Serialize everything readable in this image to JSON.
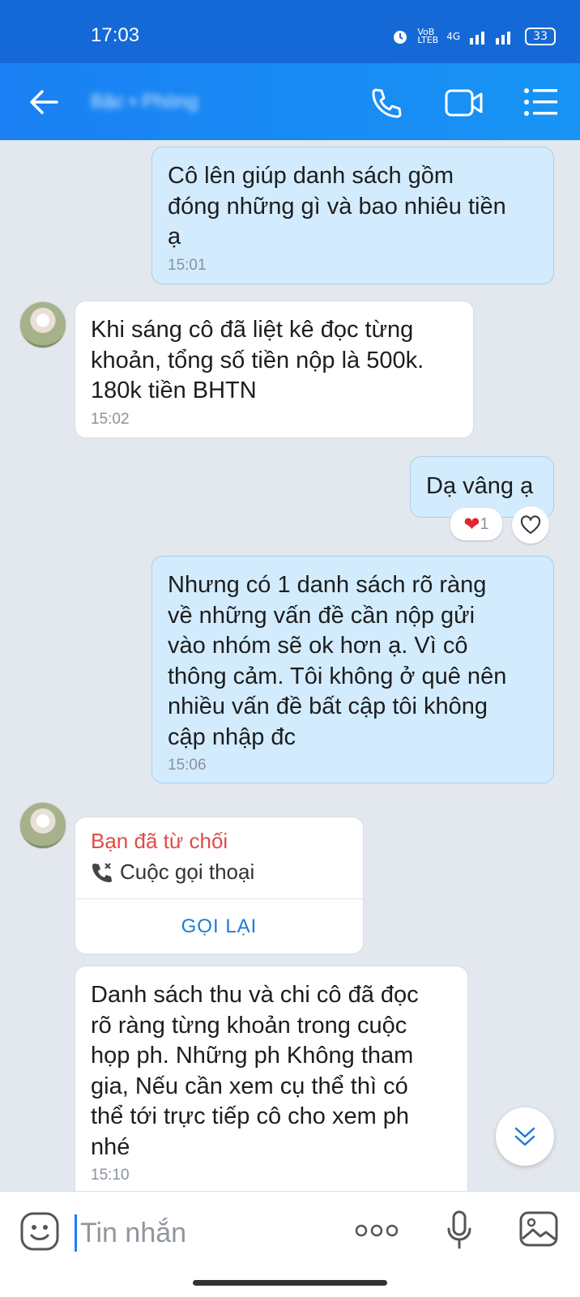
{
  "status_bar": {
    "time": "17:03",
    "network": "4G",
    "battery": "33"
  },
  "header": {
    "contact_name": "Bậc • Phòng"
  },
  "messages": [
    {
      "direction": "out",
      "text": "Cô lên giúp danh sách gồm\nđóng những gì và bao nhiêu tiền\nạ",
      "time": "15:01"
    },
    {
      "direction": "in",
      "text": "Khi sáng cô đã liệt kê đọc từng\nkhoản, tổng số tiền nộp là 500k.\n180k tiền BHTN",
      "time": "15:02"
    },
    {
      "direction": "out",
      "text": "Dạ vâng ạ",
      "reaction_count": "1"
    },
    {
      "direction": "out",
      "text": "Nhưng có 1 danh sách rõ ràng\nvề những vấn đề cần nộp gửi\nvào nhóm sẽ ok hơn ạ. Vì cô\nthông cảm. Tôi không ở quê nên\nnhiều vấn đề bất cập tôi không\ncập nhập đc",
      "time": "15:06"
    },
    {
      "direction": "in",
      "text": "Danh sách thu và chi cô đã đọc\nrõ ràng từng khoản trong cuộc\nhọp ph. Những ph Không tham\ngia, Nếu cần xem cụ thể thì có\nthể tới trực tiếp cô cho xem ph\nnhé",
      "time": "15:10"
    }
  ],
  "call_card": {
    "status": "Bạn đã từ chối",
    "type": "Cuộc gọi thoại",
    "action": "GỌI LẠI"
  },
  "input": {
    "placeholder": "Tin nhắn"
  },
  "colors": {
    "header": "#1a80f3",
    "outgoing_bubble": "#d3ecfd",
    "incoming_bubble": "#ffffff",
    "declined": "#e24b47",
    "link": "#1e7ad8"
  }
}
